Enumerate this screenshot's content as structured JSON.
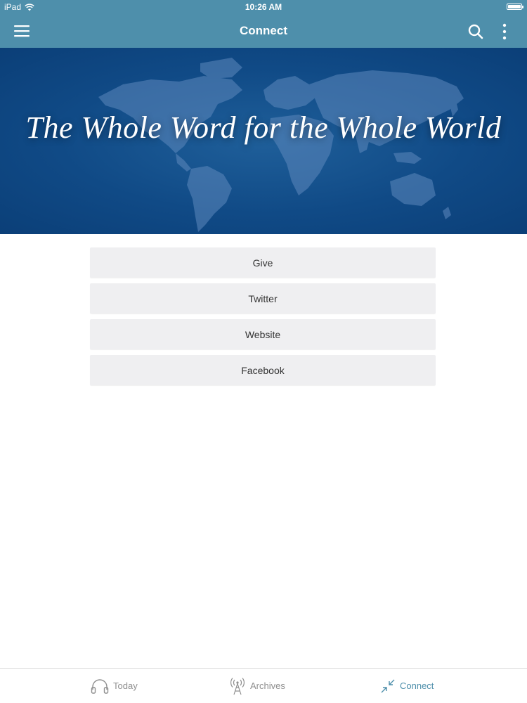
{
  "status_bar": {
    "device": "iPad",
    "time": "10:26 AM"
  },
  "navbar": {
    "title": "Connect"
  },
  "hero": {
    "tagline": "The Whole Word for the Whole World"
  },
  "links": [
    {
      "label": "Give"
    },
    {
      "label": "Twitter"
    },
    {
      "label": "Website"
    },
    {
      "label": "Facebook"
    }
  ],
  "tabs": [
    {
      "label": "Today",
      "icon": "headphones-icon",
      "active": false
    },
    {
      "label": "Archives",
      "icon": "radio-tower-icon",
      "active": false
    },
    {
      "label": "Connect",
      "icon": "connect-arrows-icon",
      "active": true
    }
  ],
  "colors": {
    "header": "#4e8fab",
    "hero_background": "#104a86",
    "button_background": "#efeff1",
    "active_tab": "#4e8fab",
    "inactive_tab": "#8f8f8f"
  }
}
